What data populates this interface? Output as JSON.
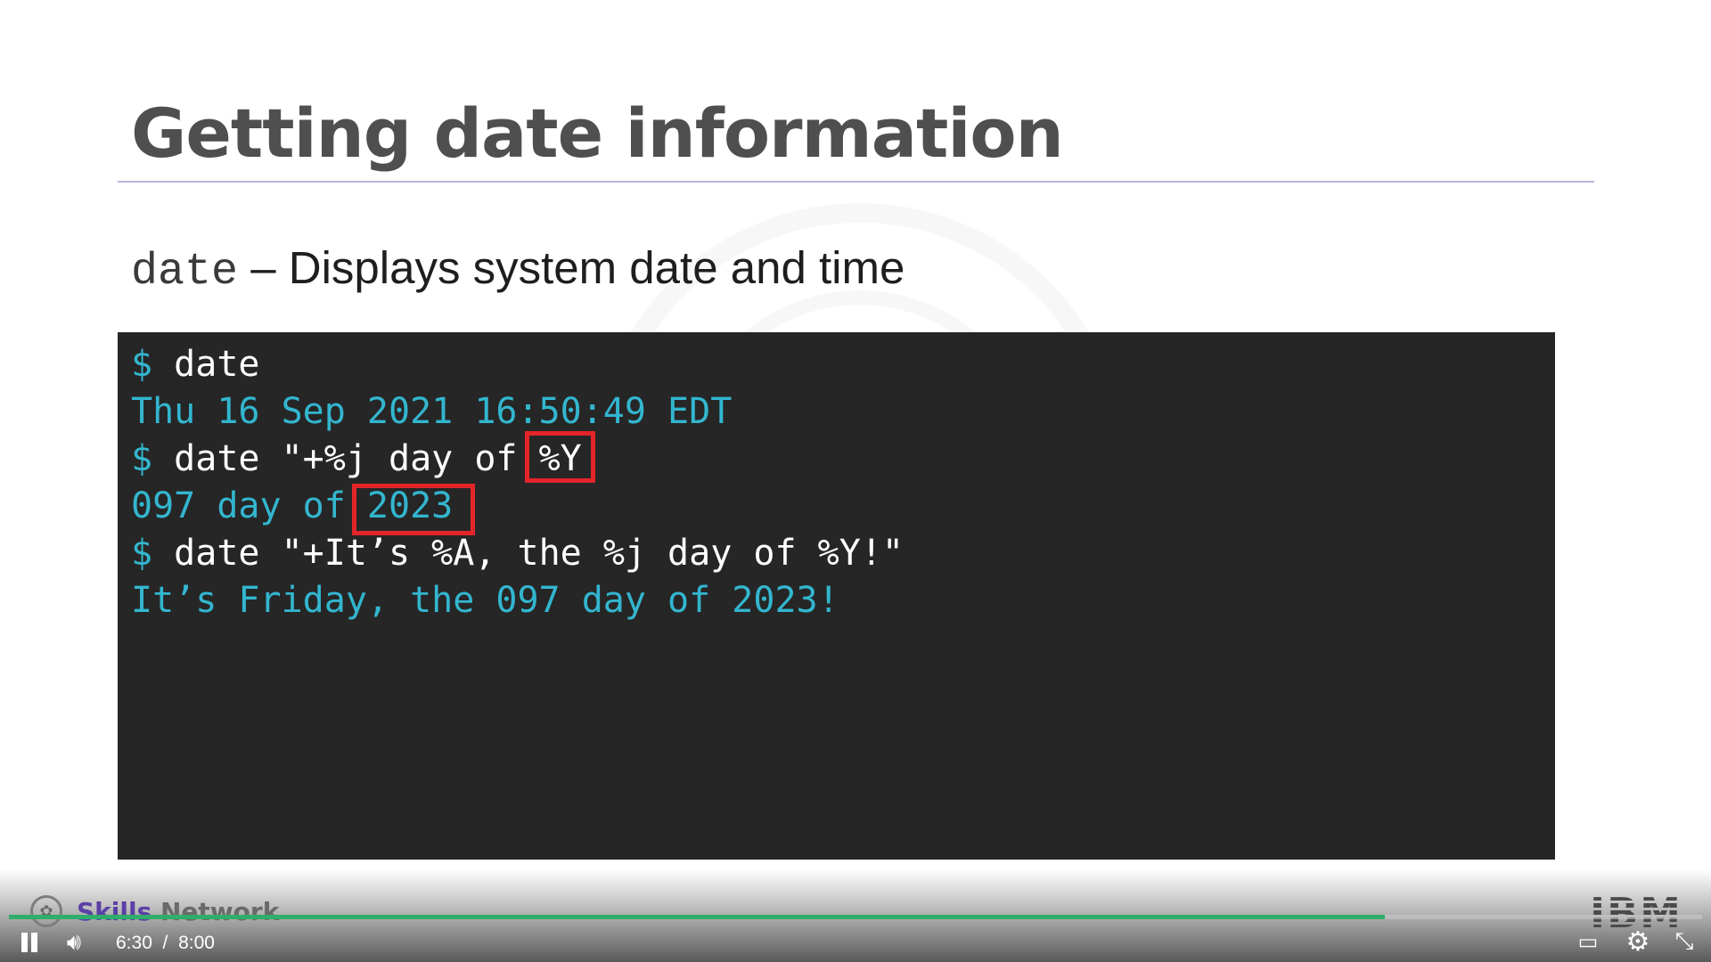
{
  "slide": {
    "title": "Getting date information",
    "subtitle_command": "date",
    "subtitle_description": " – Displays system date and time"
  },
  "terminal": {
    "lines": [
      {
        "prompt": "$ ",
        "command": "date"
      },
      {
        "output": "Thu 16 Sep 2021 16:50:49 EDT"
      },
      {
        "prompt": "$ ",
        "command": "date \"+%j day of %Y'"
      },
      {
        "output": "097 day of 2023"
      },
      {
        "prompt": "$ ",
        "command": "date \"+It’s %A, the %j day of %Y!\""
      },
      {
        "output": "It’s Friday, the 097 day of 2023!"
      }
    ],
    "highlighted": [
      "%Y",
      "2023"
    ],
    "colors": {
      "prompt": "#33b6cf",
      "command": "#ffffff",
      "output": "#33b6cf",
      "highlight": "#e3252a",
      "background": "#262626"
    }
  },
  "branding": {
    "skills": "Skills",
    "network": " Network",
    "ibm": "IBM"
  },
  "player": {
    "current_time": "6:30",
    "separator": "/",
    "duration": "8:00",
    "progress_fraction": 0.8125,
    "icons": [
      "pause-icon",
      "volume-icon",
      "captions-icon",
      "settings-gear-icon",
      "exit-fullscreen-icon"
    ]
  }
}
